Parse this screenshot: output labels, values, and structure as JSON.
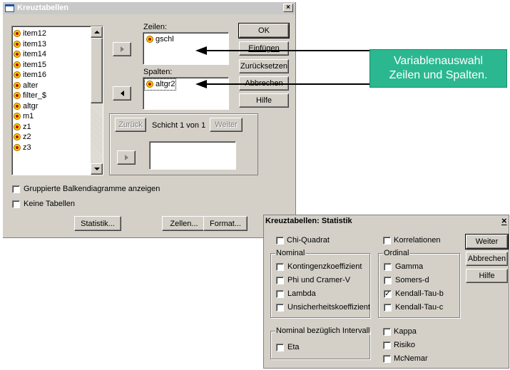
{
  "main": {
    "title": "Kreuztabellen",
    "variables": [
      "item12",
      "item13",
      "item14",
      "item15",
      "item16",
      "alter",
      "filter_$",
      "altgr",
      "m1",
      "z1",
      "z2",
      "z3"
    ],
    "rows_label": "Zeilen:",
    "rows_items": [
      "gschl"
    ],
    "cols_label": "Spalten:",
    "cols_items": [
      "altgr2"
    ],
    "btn_ok": "OK",
    "btn_insert": "Einfügen",
    "btn_reset": "Zurücksetzen",
    "btn_cancel": "Abbrechen",
    "btn_help": "Hilfe",
    "layer_back": "Zurück",
    "layer_text": "Schicht 1 von 1",
    "layer_next": "Weiter",
    "chk_clustered": "Gruppierte Balkendiagramme anzeigen",
    "chk_notables": "Keine Tabellen",
    "btn_statistics": "Statistik...",
    "btn_cells": "Zellen...",
    "btn_format": "Format..."
  },
  "callout": {
    "text_line1": "Variablenauswahl",
    "text_line2": "Zeilen und Spalten.",
    "color": "#2bb890"
  },
  "stats": {
    "title": "Kreuztabellen: Statistik",
    "chi": "Chi-Quadrat",
    "corr": "Korrelationen",
    "nominal_label": "Nominal",
    "nominal_items": [
      "Kontingenzkoeffizient",
      "Phi und Cramer-V",
      "Lambda",
      "Unsicherheitskoeffizient"
    ],
    "ordinal_label": "Ordinal",
    "ordinal_items": [
      "Gamma",
      "Somers-d",
      "Kendall-Tau-b",
      "Kendall-Tau-c"
    ],
    "interval_label": "Nominal bezüglich Intervall",
    "eta": "Eta",
    "kappa": "Kappa",
    "risk": "Risiko",
    "mcnemar": "McNemar",
    "btn_next": "Weiter",
    "btn_cancel": "Abbrechen",
    "btn_help": "Hilfe",
    "checked_ordinal_index": 2
  }
}
